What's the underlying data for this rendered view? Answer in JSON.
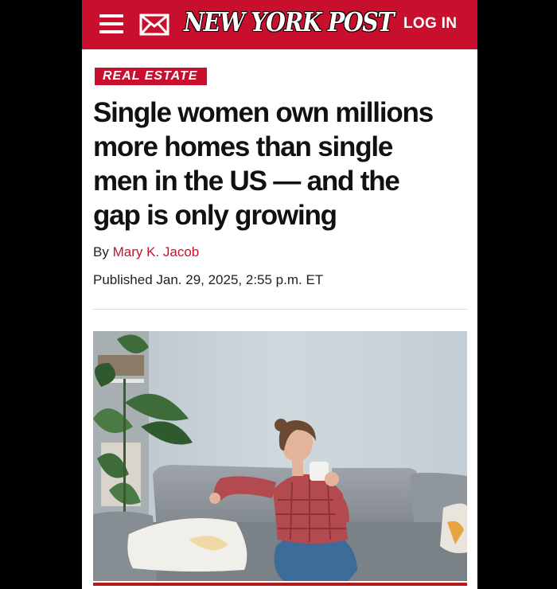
{
  "header": {
    "logo_text": "NEW YORK POST",
    "login_label": "LOG IN",
    "menu_icon": "hamburger-menu-icon",
    "mail_icon": "mail-icon",
    "brand_color": "#c8102e"
  },
  "article": {
    "section_label": "REAL ESTATE",
    "headline_lines": [
      "Single women own millions",
      "more homes than single",
      "men in the US — and the",
      "gap is only growing"
    ],
    "byline_prefix": "By",
    "author": "Mary K. Jacob",
    "published": "Published Jan. 29, 2025, 2:55 p.m. ET",
    "author_color": "#c8102e"
  }
}
